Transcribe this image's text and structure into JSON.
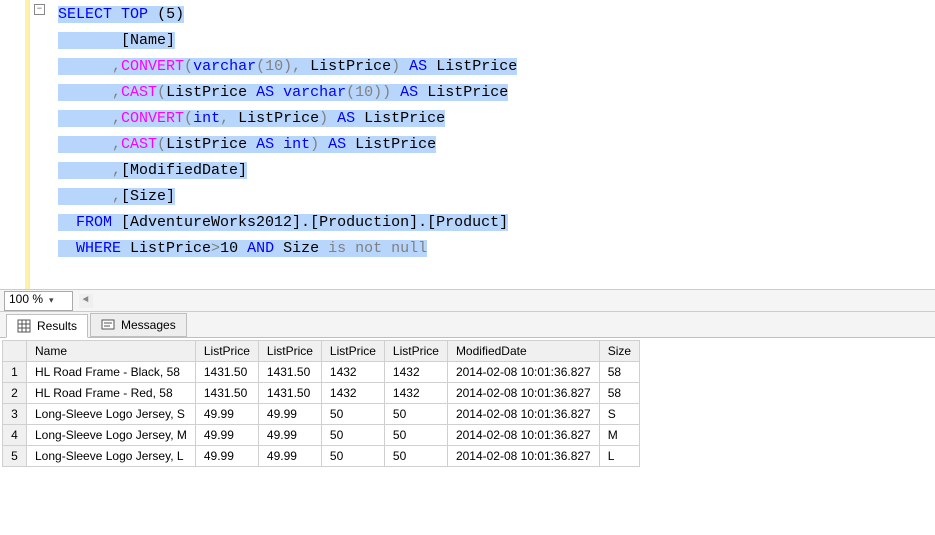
{
  "editor": {
    "collapse_glyph": "−",
    "sql": {
      "line1": {
        "select": "SELECT",
        "top": "TOP",
        "paren_open": "(",
        "num": "5",
        "paren_close": ")"
      },
      "line2": {
        "col": "[Name]"
      },
      "line3": {
        "comma": ",",
        "func": "CONVERT",
        "args_open": "(",
        "type": "varchar",
        "type_args": "(10)",
        "sep": ",",
        "arg": " ListPrice",
        "args_close": ")",
        "as": "AS",
        "alias": "ListPrice"
      },
      "line4": {
        "comma": ",",
        "func": "CAST",
        "args_open": "(",
        "arg": "ListPrice ",
        "as_inner": "AS",
        "type": " varchar",
        "type_args": "(10)",
        "args_close": ")",
        "as": "AS",
        "alias": "ListPrice"
      },
      "line5": {
        "comma": ",",
        "func": "CONVERT",
        "args_open": "(",
        "type": "int",
        "sep": ",",
        "arg": " ListPrice",
        "args_close": ")",
        "as": "AS",
        "alias": "ListPrice"
      },
      "line6": {
        "comma": ",",
        "func": "CAST",
        "args_open": "(",
        "arg": "ListPrice ",
        "as_inner": "AS",
        "type": " int",
        "args_close": ")",
        "as": "AS",
        "alias": "ListPrice"
      },
      "line7": {
        "comma": ",",
        "col": "[ModifiedDate]"
      },
      "line8": {
        "comma": ",",
        "col": "[Size]"
      },
      "line9": {
        "from": "FROM",
        "src": " [AdventureWorks2012].[Production].[Product]"
      },
      "line10": {
        "where": "WHERE",
        "pred1": " ListPrice",
        "gt": ">",
        "val": "10 ",
        "and": "AND",
        "pred2": " Size ",
        "isnotnull": "is not null"
      }
    }
  },
  "zoom": {
    "value": "100 %"
  },
  "tabs": {
    "results": "Results",
    "messages": "Messages"
  },
  "results": {
    "columns": [
      "Name",
      "ListPrice",
      "ListPrice",
      "ListPrice",
      "ListPrice",
      "ModifiedDate",
      "Size"
    ],
    "rows": [
      {
        "n": "1",
        "c": [
          "HL Road Frame - Black, 58",
          "1431.50",
          "1431.50",
          "1432",
          "1432",
          "2014-02-08 10:01:36.827",
          "58"
        ]
      },
      {
        "n": "2",
        "c": [
          "HL Road Frame - Red, 58",
          "1431.50",
          "1431.50",
          "1432",
          "1432",
          "2014-02-08 10:01:36.827",
          "58"
        ]
      },
      {
        "n": "3",
        "c": [
          "Long-Sleeve Logo Jersey, S",
          "49.99",
          "49.99",
          "50",
          "50",
          "2014-02-08 10:01:36.827",
          "S"
        ]
      },
      {
        "n": "4",
        "c": [
          "Long-Sleeve Logo Jersey, M",
          "49.99",
          "49.99",
          "50",
          "50",
          "2014-02-08 10:01:36.827",
          "M"
        ]
      },
      {
        "n": "5",
        "c": [
          "Long-Sleeve Logo Jersey, L",
          "49.99",
          "49.99",
          "50",
          "50",
          "2014-02-08 10:01:36.827",
          "L"
        ]
      }
    ]
  }
}
